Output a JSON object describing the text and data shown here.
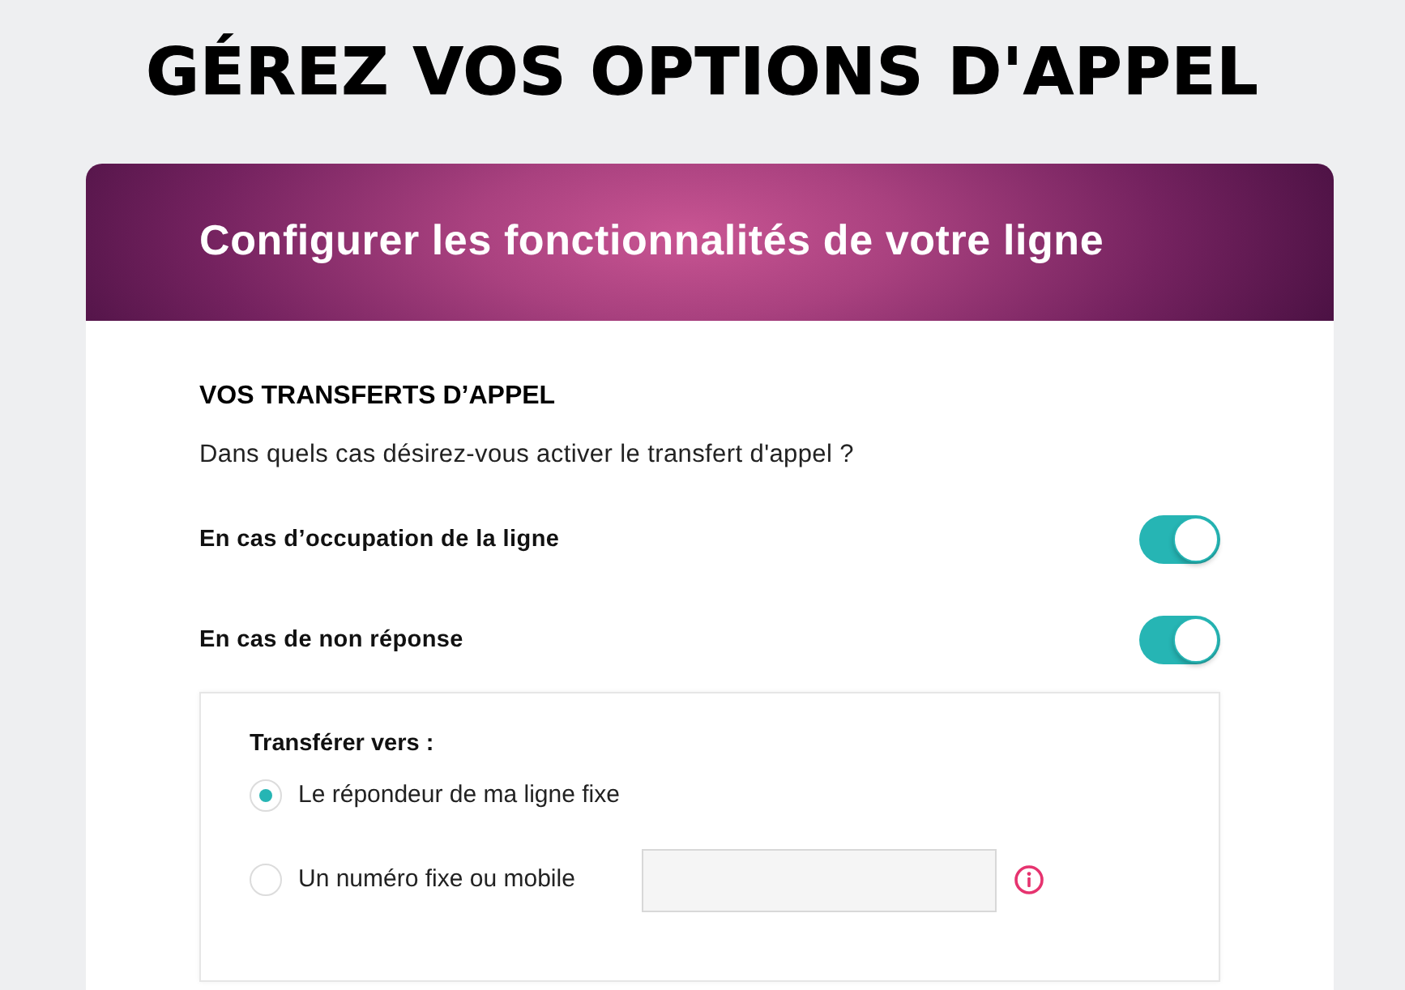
{
  "page_title": "GÉREZ VOS OPTIONS D'APPEL",
  "card": {
    "header_title": "Configurer les fonctionnalités de votre ligne",
    "section_title": "VOS TRANSFERTS D’APPEL",
    "question": "Dans quels cas désirez-vous activer le transfert d'appel ?",
    "toggles": [
      {
        "label": "En cas d’occupation de la ligne",
        "on": true
      },
      {
        "label": "En cas de non réponse",
        "on": true
      }
    ],
    "transfer_panel": {
      "title": "Transférer vers :",
      "options": [
        {
          "kind": "plain",
          "label": "Le répondeur de ma ligne fixe",
          "selected": true
        },
        {
          "kind": "with-field",
          "label": "Un numéro fixe ou mobile",
          "selected": false
        }
      ]
    }
  }
}
